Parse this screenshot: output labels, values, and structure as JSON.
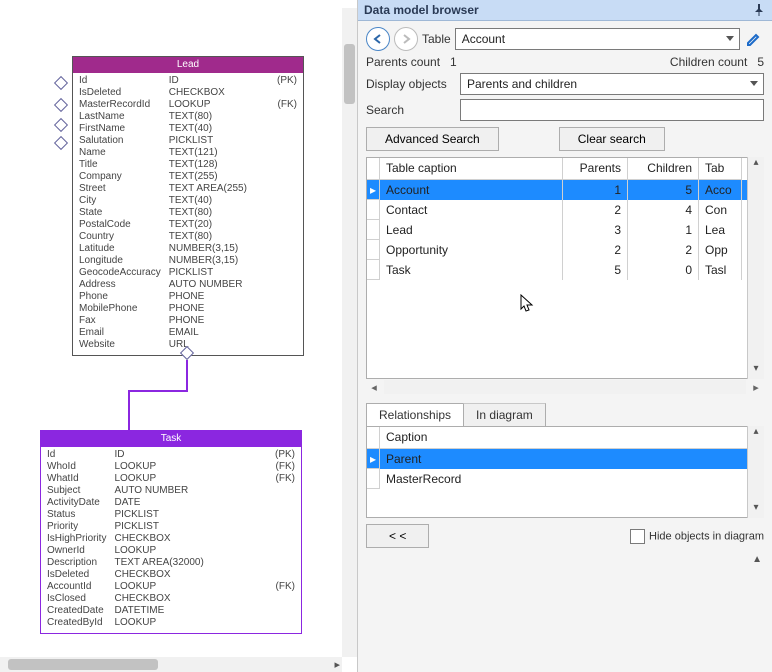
{
  "panel_title": "Data model browser",
  "toolbar": {
    "table_label": "Table",
    "table_value": "Account",
    "parents_count_label": "Parents count",
    "parents_count_value": "1",
    "children_count_label": "Children count",
    "children_count_value": "5",
    "display_label": "Display objects",
    "display_value": "Parents and children",
    "search_label": "Search",
    "search_value": "",
    "advanced_search": "Advanced Search",
    "clear_search": "Clear search"
  },
  "grid": {
    "columns": [
      "Table caption",
      "Parents",
      "Children",
      "Tab"
    ],
    "rows": [
      {
        "caption": "Account",
        "parents": "1",
        "children": "5",
        "tab": "Acco",
        "selected": true
      },
      {
        "caption": "Contact",
        "parents": "2",
        "children": "4",
        "tab": "Con",
        "selected": false
      },
      {
        "caption": "Lead",
        "parents": "3",
        "children": "1",
        "tab": "Lea",
        "selected": false
      },
      {
        "caption": "Opportunity",
        "parents": "2",
        "children": "2",
        "tab": "Opp",
        "selected": false
      },
      {
        "caption": "Task",
        "parents": "5",
        "children": "0",
        "tab": "Tasl",
        "selected": false
      }
    ]
  },
  "tabs": {
    "relationships": "Relationships",
    "in_diagram": "In diagram"
  },
  "relationships": {
    "header": "Caption",
    "rows": [
      {
        "caption": "Parent",
        "selected": true
      },
      {
        "caption": "MasterRecord",
        "selected": false
      }
    ]
  },
  "footer": {
    "collapse_label": "< <",
    "hide_label": "Hide objects in diagram"
  },
  "entities": {
    "lead": {
      "title": "Lead",
      "rows": [
        {
          "name": "Id",
          "type": "ID",
          "key": "(PK)"
        },
        {
          "name": "IsDeleted",
          "type": "CHECKBOX",
          "key": ""
        },
        {
          "name": "MasterRecordId",
          "type": "LOOKUP",
          "key": "(FK)"
        },
        {
          "name": "LastName",
          "type": "TEXT(80)",
          "key": ""
        },
        {
          "name": "FirstName",
          "type": "TEXT(40)",
          "key": ""
        },
        {
          "name": "Salutation",
          "type": "PICKLIST",
          "key": ""
        },
        {
          "name": "Name",
          "type": "TEXT(121)",
          "key": ""
        },
        {
          "name": "Title",
          "type": "TEXT(128)",
          "key": ""
        },
        {
          "name": "Company",
          "type": "TEXT(255)",
          "key": ""
        },
        {
          "name": "Street",
          "type": "TEXT AREA(255)",
          "key": ""
        },
        {
          "name": "City",
          "type": "TEXT(40)",
          "key": ""
        },
        {
          "name": "State",
          "type": "TEXT(80)",
          "key": ""
        },
        {
          "name": "PostalCode",
          "type": "TEXT(20)",
          "key": ""
        },
        {
          "name": "Country",
          "type": "TEXT(80)",
          "key": ""
        },
        {
          "name": "Latitude",
          "type": "NUMBER(3,15)",
          "key": ""
        },
        {
          "name": "Longitude",
          "type": "NUMBER(3,15)",
          "key": ""
        },
        {
          "name": "GeocodeAccuracy",
          "type": "PICKLIST",
          "key": ""
        },
        {
          "name": "Address",
          "type": "AUTO NUMBER",
          "key": ""
        },
        {
          "name": "Phone",
          "type": "PHONE",
          "key": ""
        },
        {
          "name": "MobilePhone",
          "type": "PHONE",
          "key": ""
        },
        {
          "name": "Fax",
          "type": "PHONE",
          "key": ""
        },
        {
          "name": "Email",
          "type": "EMAIL",
          "key": ""
        },
        {
          "name": "Website",
          "type": "URL",
          "key": ""
        }
      ]
    },
    "task": {
      "title": "Task",
      "rows": [
        {
          "name": "Id",
          "type": "ID",
          "key": "(PK)"
        },
        {
          "name": "WhoId",
          "type": "LOOKUP",
          "key": "(FK)"
        },
        {
          "name": "WhatId",
          "type": "LOOKUP",
          "key": "(FK)"
        },
        {
          "name": "Subject",
          "type": "AUTO NUMBER",
          "key": ""
        },
        {
          "name": "ActivityDate",
          "type": "DATE",
          "key": ""
        },
        {
          "name": "Status",
          "type": "PICKLIST",
          "key": ""
        },
        {
          "name": "Priority",
          "type": "PICKLIST",
          "key": ""
        },
        {
          "name": "IsHighPriority",
          "type": "CHECKBOX",
          "key": ""
        },
        {
          "name": "OwnerId",
          "type": "LOOKUP",
          "key": ""
        },
        {
          "name": "Description",
          "type": "TEXT AREA(32000)",
          "key": ""
        },
        {
          "name": "IsDeleted",
          "type": "CHECKBOX",
          "key": ""
        },
        {
          "name": "AccountId",
          "type": "LOOKUP",
          "key": "(FK)"
        },
        {
          "name": "IsClosed",
          "type": "CHECKBOX",
          "key": ""
        },
        {
          "name": "CreatedDate",
          "type": "DATETIME",
          "key": ""
        },
        {
          "name": "CreatedById",
          "type": "LOOKUP",
          "key": ""
        }
      ]
    }
  }
}
